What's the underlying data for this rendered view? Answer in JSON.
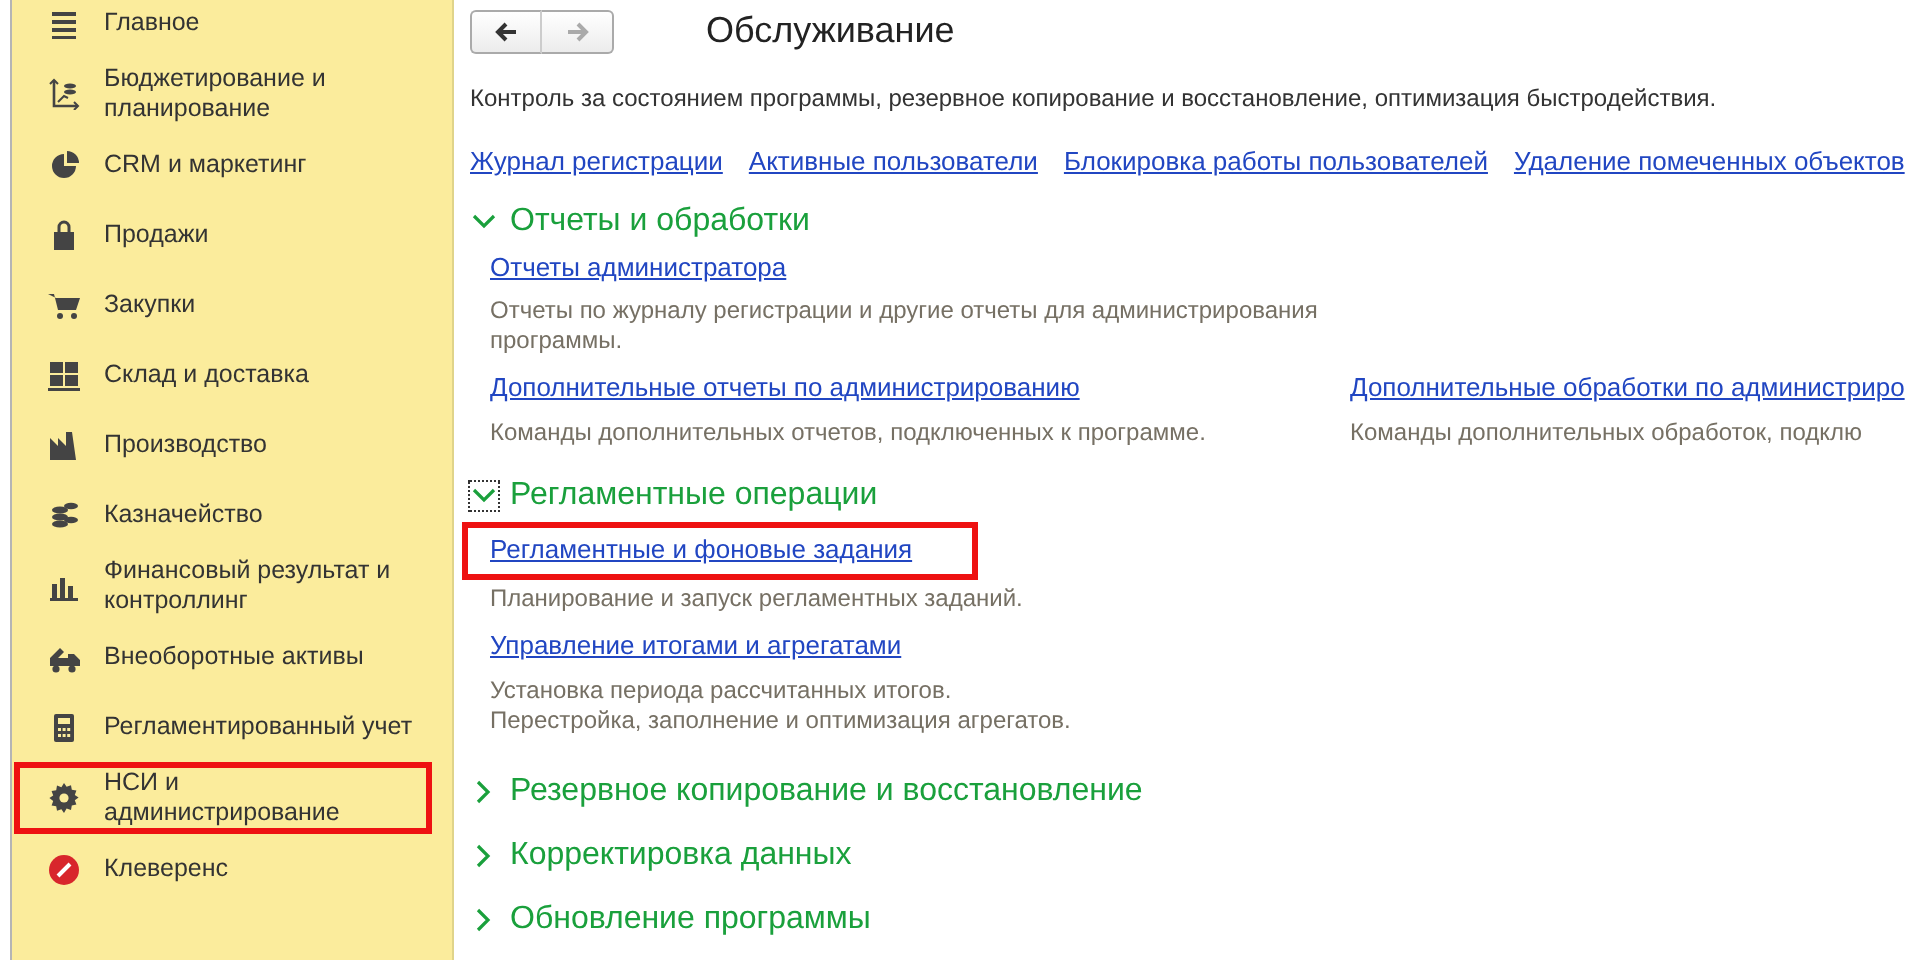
{
  "sidebar": {
    "items": [
      {
        "label": "Главное",
        "highlighted": false
      },
      {
        "label": "Бюджетирование и планирование",
        "highlighted": false
      },
      {
        "label": "CRM и маркетинг",
        "highlighted": false
      },
      {
        "label": "Продажи",
        "highlighted": false
      },
      {
        "label": "Закупки",
        "highlighted": false
      },
      {
        "label": "Склад и доставка",
        "highlighted": false
      },
      {
        "label": "Производство",
        "highlighted": false
      },
      {
        "label": "Казначейство",
        "highlighted": false
      },
      {
        "label": "Финансовый результат и контроллинг",
        "highlighted": false
      },
      {
        "label": "Внеоборотные активы",
        "highlighted": false
      },
      {
        "label": "Регламентированный учет",
        "highlighted": false
      },
      {
        "label": "НСИ и администрирование",
        "highlighted": true
      },
      {
        "label": "Клеверенс",
        "highlighted": false
      }
    ]
  },
  "navigation": {
    "back": {
      "disabled": false
    },
    "forward": {
      "disabled": true
    }
  },
  "title": "Обслуживание",
  "description": "Контроль за состоянием программы, резервное копирование и восстановление, оптимизация быстродействия.",
  "links": [
    "Журнал регистрации",
    "Активные пользователи",
    "Блокировка работы пользователей",
    "Удаление помеченных объектов"
  ],
  "sections": [
    {
      "title": "Отчеты и обработки",
      "expanded": true,
      "focused": false,
      "rows": [
        [
          {
            "link": "Отчеты администратора",
            "description": "Отчеты по журналу регистрации и другие отчеты для администрирования программы.",
            "highlighted": false
          }
        ],
        [
          {
            "link": "Дополнительные отчеты по администрированию",
            "description": "Команды дополнительных отчетов, подключенных к программе.",
            "highlighted": false
          },
          {
            "link": "Дополнительные обработки по администриро",
            "description": "Команды дополнительных обработок, подклю",
            "highlighted": false
          }
        ]
      ]
    },
    {
      "title": "Регламентные операции",
      "expanded": true,
      "focused": true,
      "rows": [
        [
          {
            "link": "Регламентные и фоновые задания",
            "description": "Планирование и запуск регламентных заданий.",
            "highlighted": true
          }
        ],
        [
          {
            "link": "Управление итогами и агрегатами",
            "description": "Установка периода рассчитанных итогов.\nПерестройка, заполнение и оптимизация агрегатов.",
            "highlighted": false
          }
        ]
      ]
    },
    {
      "title": "Резервное копирование и восстановление",
      "expanded": false,
      "focused": false
    },
    {
      "title": "Корректировка данных",
      "expanded": false,
      "focused": false
    },
    {
      "title": "Обновление программы",
      "expanded": false,
      "focused": false
    }
  ]
}
